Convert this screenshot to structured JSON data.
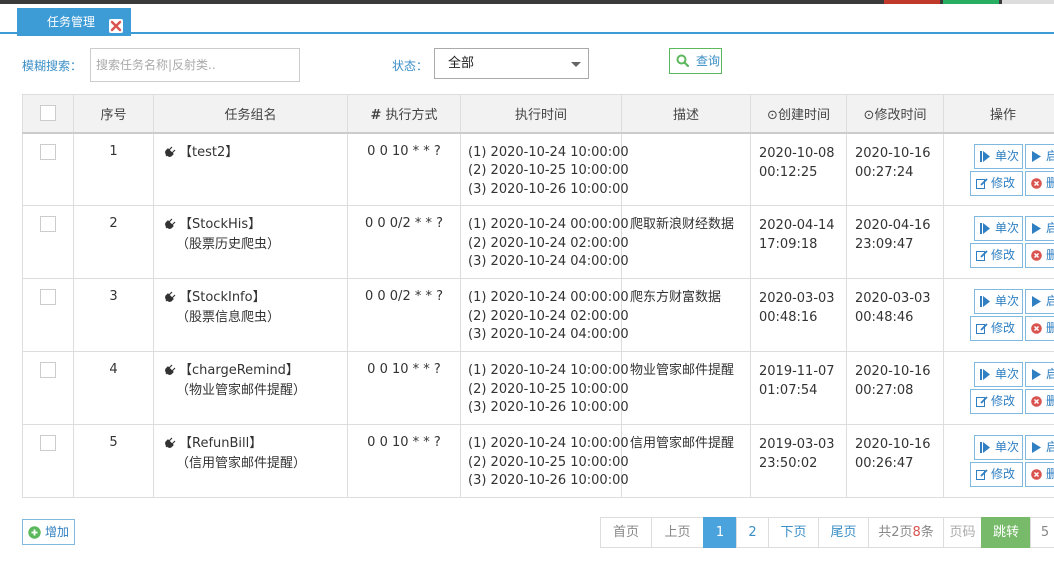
{
  "colors": {
    "accent": "#3d9bd6",
    "link": "#3b8fc6",
    "success": "#5cb85c",
    "danger": "#d9534f"
  },
  "tab": {
    "title": "任务管理",
    "close_icon": "close-icon"
  },
  "filters": {
    "search_label": "模糊搜索：",
    "search_placeholder": "搜索任务名称|反射类..",
    "status_label": "状态：",
    "status_value": "全部",
    "query_label": "查询"
  },
  "table": {
    "headers": {
      "seq": "序号",
      "name": "任务组名",
      "cron": "执行方式",
      "times": "执行时间",
      "desc": "描述",
      "created": "创建时间",
      "modified": "修改时间",
      "ops": "操作"
    },
    "rows": [
      {
        "seq": "1",
        "name": "【test2】",
        "sub": "",
        "cron": "0 0 10 * * ?",
        "times": [
          "(1) 2020-10-24 10:00:00",
          "(2) 2020-10-25 10:00:00",
          "(3) 2020-10-26 10:00:00"
        ],
        "desc": "",
        "created": "2020-10-08 00:12:25",
        "modified": "2020-10-16 00:27:24"
      },
      {
        "seq": "2",
        "name": "【StockHis】",
        "sub": "（股票历史爬虫）",
        "cron": "0 0 0/2 * * ?",
        "times": [
          "(1) 2020-10-24 00:00:00",
          "(2) 2020-10-24 02:00:00",
          "(3) 2020-10-24 04:00:00"
        ],
        "desc": "爬取新浪财经数据",
        "created": "2020-04-14 17:09:18",
        "modified": "2020-04-16 23:09:47"
      },
      {
        "seq": "3",
        "name": "【StockInfo】",
        "sub": "（股票信息爬虫）",
        "cron": "0 0 0/2 * * ?",
        "times": [
          "(1) 2020-10-24 00:00:00",
          "(2) 2020-10-24 02:00:00",
          "(3) 2020-10-24 04:00:00"
        ],
        "desc": "爬东方财富数据",
        "created": "2020-03-03 00:48:16",
        "modified": "2020-03-03 00:48:46"
      },
      {
        "seq": "4",
        "name": "【chargeRemind】",
        "sub": "（物业管家邮件提醒）",
        "cron": "0 0 10 * * ?",
        "times": [
          "(1) 2020-10-24 10:00:00",
          "(2) 2020-10-25 10:00:00",
          "(3) 2020-10-26 10:00:00"
        ],
        "desc": "物业管家邮件提醒",
        "created": "2019-11-07 01:07:54",
        "modified": "2020-10-16 00:27:08"
      },
      {
        "seq": "5",
        "name": "【RefunBill】",
        "sub": "（信用管家邮件提醒）",
        "cron": "0 0 10 * * ?",
        "times": [
          "(1) 2020-10-24 10:00:00",
          "(2) 2020-10-25 10:00:00",
          "(3) 2020-10-26 10:00:00"
        ],
        "desc": "信用管家邮件提醒",
        "created": "2019-03-03 23:50:02",
        "modified": "2020-10-16 00:26:47"
      }
    ],
    "op_labels": {
      "single": "单次",
      "start": "启",
      "edit": "修改",
      "delete": "删"
    }
  },
  "footer": {
    "add_label": "增加",
    "pager": {
      "first": "首页",
      "prev": "上页",
      "pages": [
        "1",
        "2"
      ],
      "current": "1",
      "next": "下页",
      "last": "尾页",
      "summary_prefix": "共2页",
      "summary_count": "8",
      "summary_suffix": "条",
      "page_input_label": "页码",
      "jump_label": "跳转",
      "page_size": "5"
    }
  }
}
